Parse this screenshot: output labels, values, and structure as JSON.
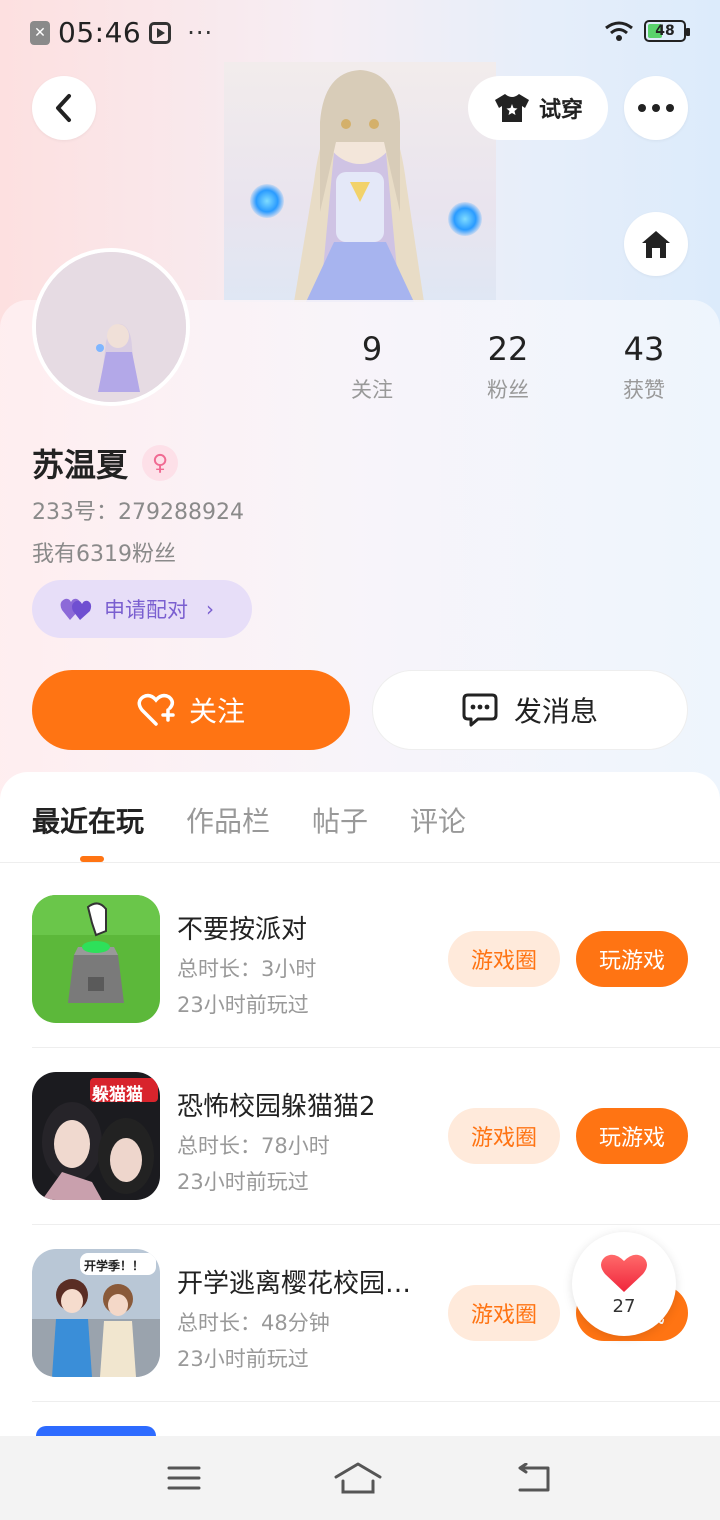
{
  "status_bar": {
    "time": "05:46",
    "dots": "···",
    "battery": "48",
    "battery_level": 0.48
  },
  "header": {
    "tryon_label": "试穿"
  },
  "profile": {
    "stats": [
      {
        "num": "9",
        "label": "关注"
      },
      {
        "num": "22",
        "label": "粉丝"
      },
      {
        "num": "43",
        "label": "获赞"
      }
    ],
    "username": "苏温夏",
    "uid": "233号：279288924",
    "fans_text": "我有6319粉丝",
    "match_label": "申请配对",
    "follow_label": "关注",
    "message_label": "发消息"
  },
  "tabs": [
    {
      "label": "最近在玩"
    },
    {
      "label": "作品栏"
    },
    {
      "label": "帖子"
    },
    {
      "label": "评论"
    }
  ],
  "games": [
    {
      "name": "不要按派对",
      "duration": "总时长：3小时",
      "last_played": "23小时前玩过",
      "circle_label": "游戏圈",
      "play_label": "玩游戏"
    },
    {
      "name": "恐怖校园躲猫猫2",
      "duration": "总时长：78小时",
      "last_played": "23小时前玩过",
      "circle_label": "游戏圈",
      "play_label": "玩游戏",
      "icon_text": "躲猫猫"
    },
    {
      "name": "开学逃离樱花校园…",
      "duration": "总时长：48分钟",
      "last_played": "23小时前玩过",
      "circle_label": "游戏圈",
      "play_label": "玩游戏",
      "icon_text": "开学季！！"
    }
  ],
  "like_float": {
    "count": "27"
  },
  "colors": {
    "accent": "#ff7413",
    "accent_light": "#ffeadb",
    "match_bg": "#e7def8",
    "match_text": "#7a5fd0"
  },
  "icons": [
    "back-icon",
    "tshirt-icon",
    "more-icon",
    "home-icon",
    "heart-icon",
    "chat-icon",
    "female-icon",
    "menu-icon",
    "nav-home-icon",
    "nav-back-icon"
  ]
}
